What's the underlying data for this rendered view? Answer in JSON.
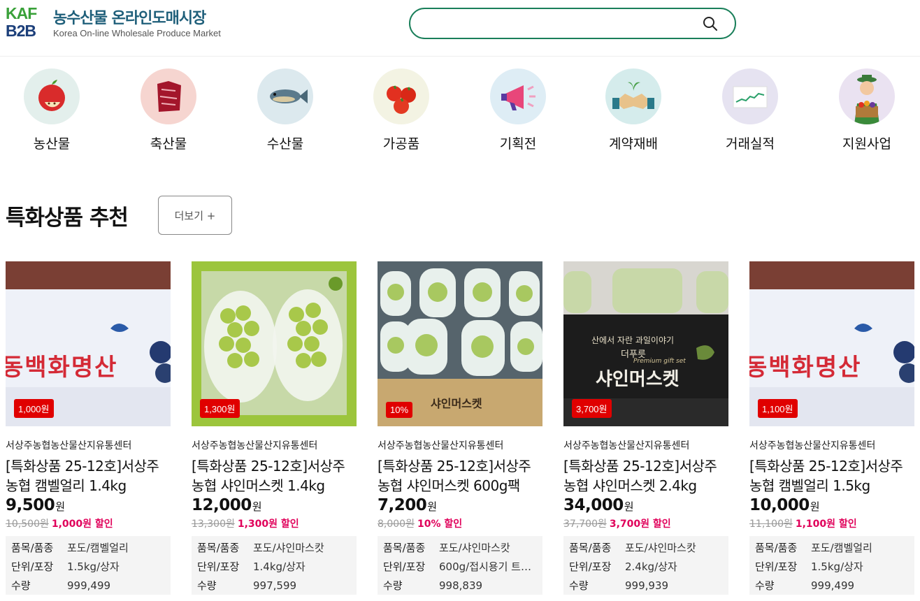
{
  "brand": {
    "logo_line1": "KAF",
    "logo_line2": "B2B",
    "title": "농수산물 온라인도매시장",
    "subtitle": "Korea On-line Wholesale Produce Market"
  },
  "search": {
    "value": "",
    "placeholder": "",
    "icon": "search-icon"
  },
  "categories": [
    {
      "label": "농산물",
      "icon": "apple-icon",
      "bg": "#e3efec"
    },
    {
      "label": "축산물",
      "icon": "meat-icon",
      "bg": "#f6d5d0"
    },
    {
      "label": "수산물",
      "icon": "fish-icon",
      "bg": "#dce9ee"
    },
    {
      "label": "가공품",
      "icon": "tomato-icon",
      "bg": "#f3f3e3"
    },
    {
      "label": "기획전",
      "icon": "megaphone-icon",
      "bg": "#deedf5"
    },
    {
      "label": "계약재배",
      "icon": "handshake-icon",
      "bg": "#d5ecec"
    },
    {
      "label": "거래실적",
      "icon": "chart-icon",
      "bg": "#e6e3f1"
    },
    {
      "label": "지원사업",
      "icon": "farmer-icon",
      "bg": "#eae2f1"
    }
  ],
  "section": {
    "title": "특화상품 추천",
    "more_label": "더보기 +"
  },
  "spec_labels": {
    "item": "품목/품종",
    "unit": "단위/포장",
    "qty": "수량"
  },
  "products": [
    {
      "badge": "1,000원",
      "seller": "서상주농협농산물산지유통센터",
      "name": "[특화상품 25-12호]서상주농협 캠벨얼리 1.4kg",
      "price": "9,500",
      "won": "원",
      "orig_price": "10,500원",
      "discount": "1,000원 할인",
      "item": "포도/캠벨얼리",
      "unit": "1.5kg/상자",
      "qty": "999,499",
      "image_text": "동백화명산",
      "image_type": "box-red"
    },
    {
      "badge": "1,300원",
      "seller": "서상주농협농산물산지유통센터",
      "name": "[특화상품 25-12호]서상주농협 샤인머스켓 1.4kg",
      "price": "12,000",
      "won": "원",
      "orig_price": "13,300원",
      "discount": "1,300원 할인",
      "item": "포도/샤인마스캇",
      "unit": "1.4kg/상자",
      "qty": "997,599",
      "image_text": "",
      "image_type": "grapes-box"
    },
    {
      "badge": "10%",
      "seller": "서상주농협농산물산지유통센터",
      "name": "[특화상품 25-12호]서상주농협 샤인머스켓 600g팩",
      "price": "7,200",
      "won": "원",
      "orig_price": "8,000원",
      "discount": "10% 할인",
      "item": "포도/샤인마스캇",
      "unit": "600g/접시용기 트…",
      "qty": "998,839",
      "image_text": "샤인머스켓",
      "image_type": "grapes-packs"
    },
    {
      "badge": "3,700원",
      "seller": "서상주농협농산물산지유통센터",
      "name": "[특화상품 25-12호]서상주농협 샤인머스켓 2.4kg",
      "price": "34,000",
      "won": "원",
      "orig_price": "37,700원",
      "discount": "3,700원 할인",
      "item": "포도/샤인마스캇",
      "unit": "2.4kg/상자",
      "qty": "999,939",
      "image_text": "샤인머스켓",
      "image_text2": "산에서 자란 과일이야기",
      "image_text3": "더푸릇",
      "image_text4": "Premium gift set",
      "image_type": "gift-box"
    },
    {
      "badge": "1,100원",
      "seller": "서상주농협농산물산지유통센터",
      "name": "[특화상품 25-12호]서상주농협 캠벨얼리 1.5kg",
      "price": "10,000",
      "won": "원",
      "orig_price": "11,100원",
      "discount": "1,100원 할인",
      "item": "포도/캠벨얼리",
      "unit": "1.5kg/상자",
      "qty": "999,499",
      "image_text": "동백화명산",
      "image_type": "box-red"
    }
  ],
  "colors": {
    "accent": "#1a7f5a",
    "badge": "#e00000",
    "discount": "#e0005a"
  }
}
